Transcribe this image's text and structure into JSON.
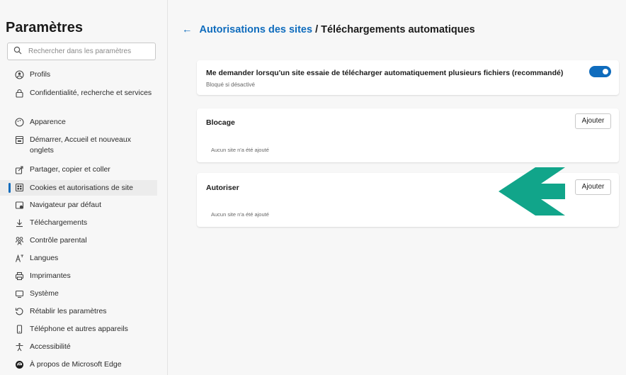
{
  "sidebar": {
    "title": "Paramètres",
    "search_placeholder": "Rechercher dans les paramètres",
    "items": [
      {
        "label": "Profils",
        "icon": "profile-icon"
      },
      {
        "label": "Confidentialité, recherche et services",
        "icon": "lock-icon"
      },
      {
        "label": "Apparence",
        "icon": "appearance-icon"
      },
      {
        "label": "Démarrer, Accueil et nouveaux onglets",
        "icon": "home-tab-icon"
      },
      {
        "label": "Partager, copier et coller",
        "icon": "share-icon"
      },
      {
        "label": "Cookies et autorisations de site",
        "icon": "cookies-icon",
        "active": true
      },
      {
        "label": "Navigateur par défaut",
        "icon": "browser-icon"
      },
      {
        "label": "Téléchargements",
        "icon": "download-icon"
      },
      {
        "label": "Contrôle parental",
        "icon": "family-icon"
      },
      {
        "label": "Langues",
        "icon": "language-icon"
      },
      {
        "label": "Imprimantes",
        "icon": "printer-icon"
      },
      {
        "label": "Système",
        "icon": "system-icon"
      },
      {
        "label": "Rétablir les paramètres",
        "icon": "reset-icon"
      },
      {
        "label": "Téléphone et autres appareils",
        "icon": "phone-icon"
      },
      {
        "label": "Accessibilité",
        "icon": "accessibility-icon"
      },
      {
        "label": "À propos de Microsoft Edge",
        "icon": "edge-icon"
      }
    ]
  },
  "header": {
    "back_glyph": "←",
    "link": "Autorisations des sites",
    "separator": " / ",
    "current": "Téléchargements automatiques"
  },
  "toggle_card": {
    "title": "Me demander lorsqu'un site essaie de télécharger automatiquement plusieurs fichiers (recommandé)",
    "subtitle": "Bloqué si désactivé",
    "enabled": true
  },
  "block_card": {
    "title": "Blocage",
    "button": "Ajouter",
    "empty": "Aucun site n'a été ajouté"
  },
  "allow_card": {
    "title": "Autoriser",
    "button": "Ajouter",
    "empty": "Aucun site n'a été ajouté"
  },
  "colors": {
    "accent": "#0f6cbd",
    "arrow": "#11a58a"
  }
}
